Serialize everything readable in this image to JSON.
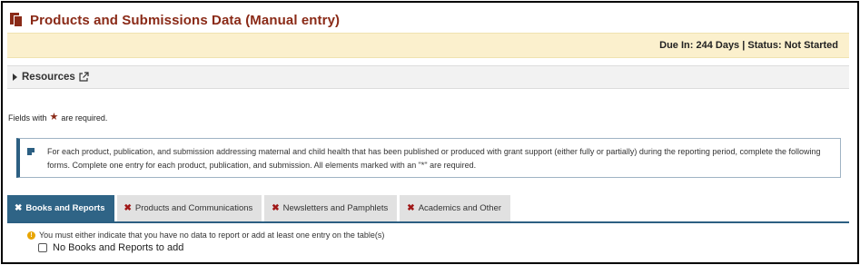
{
  "page": {
    "title": "Products and Submissions Data (Manual entry)",
    "title_icon": "document-copy-icon"
  },
  "status_bar": {
    "text": "Due In: 244 Days | Status: Not Started"
  },
  "resources": {
    "label": "Resources",
    "icon": "external-link-icon",
    "expanded": false
  },
  "required_note": {
    "prefix": "Fields with",
    "star": "★",
    "suffix": "are required."
  },
  "info": {
    "text": "For each product, publication, and submission addressing maternal and child health that has been published or produced with grant support (either fully or partially) during the reporting period, complete the following forms. Complete one entry for each product, publication, and submission. All elements marked with an \"*\" are required."
  },
  "tabs": [
    {
      "label": "Books and Reports",
      "active": true
    },
    {
      "label": "Products and Communications",
      "active": false
    },
    {
      "label": "Newsletters and Pamphlets",
      "active": false
    },
    {
      "label": "Academics and Other",
      "active": false
    }
  ],
  "warning": {
    "text": "You must either indicate that you have no data to report or add at least one entry on the table(s)"
  },
  "checkbox": {
    "label": "No Books and Reports to add",
    "checked": false
  },
  "colors": {
    "title": "#8a2a17",
    "due_bar_bg": "#fbf0cd",
    "tab_active_bg": "#2f6486",
    "tab_inactive_bg": "#e1e1e1",
    "tab_x": "#a01818",
    "warning": "#e8a500"
  }
}
